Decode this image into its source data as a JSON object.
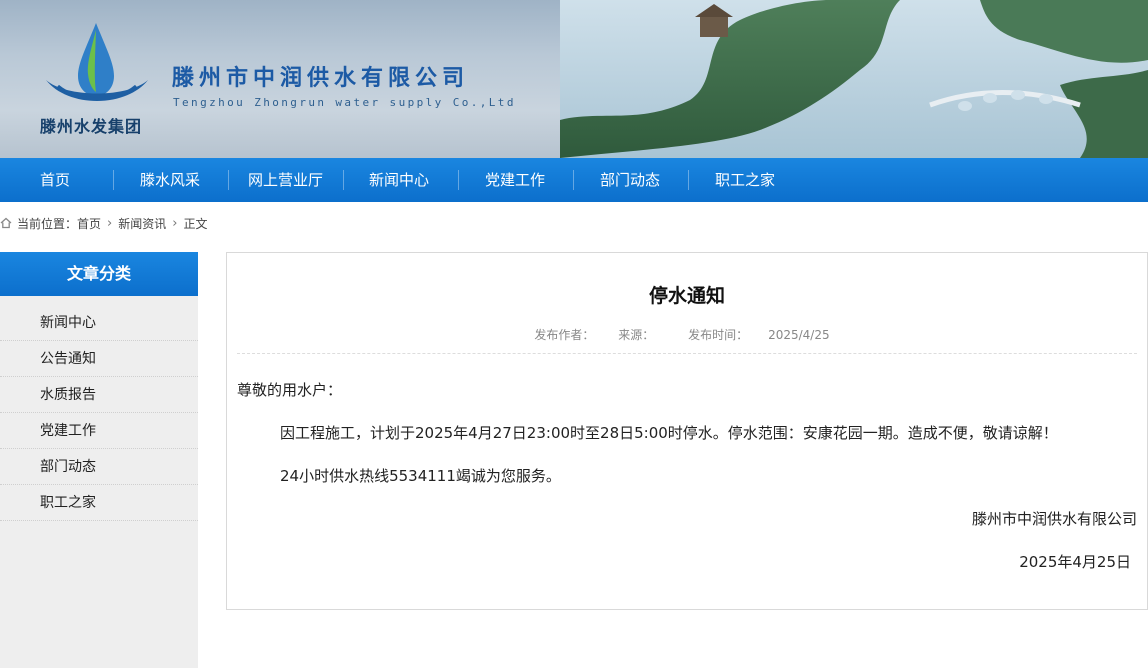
{
  "header": {
    "logo_text": "滕州水发集团",
    "company_cn": "滕州市中润供水有限公司",
    "company_en": "Tengzhou Zhongrun water supply Co.,Ltd",
    "brand_color": "#1c5aa5"
  },
  "nav": {
    "items": [
      "首页",
      "滕水风采",
      "网上营业厅",
      "新闻中心",
      "党建工作",
      "部门动态",
      "职工之家"
    ],
    "bar_color": "#0c6fcc"
  },
  "breadcrumb": {
    "prefix": "当前位置：",
    "items": [
      "首页",
      "新闻资讯",
      "正文"
    ],
    "icon": "home-icon",
    "separator_icon": "chevron-right-icon"
  },
  "sidebar": {
    "title": "文章分类",
    "items": [
      "新闻中心",
      "公告通知",
      "水质报告",
      "党建工作",
      "部门动态",
      "职工之家"
    ]
  },
  "article": {
    "title": "停水通知",
    "meta": {
      "author_label": "发布作者：",
      "source_label": "来源：",
      "time_label": "发布时间：",
      "time_value": "2025/4/25"
    },
    "greeting": "尊敬的用水户：",
    "paragraph1": "因工程施工，计划于2025年4月27日23:00时至28日5:00时停水。停水范围：安康花园一期。造成不便，敬请谅解！",
    "paragraph2": "24小时供水热线5534111竭诚为您服务。",
    "sign_company": "滕州市中润供水有限公司",
    "sign_date": "2025年4月25日"
  }
}
